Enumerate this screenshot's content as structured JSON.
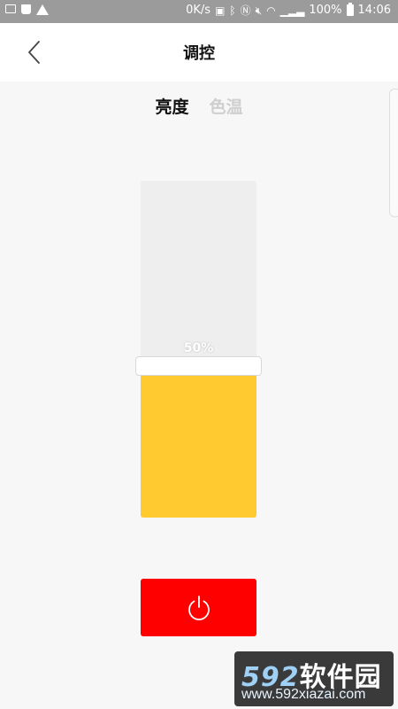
{
  "statusbar": {
    "speed": "0K/s",
    "battery_percent": "100%",
    "time": "14:06"
  },
  "header": {
    "title": "调控",
    "back_icon": "chevron-left-icon"
  },
  "tabs": [
    {
      "label": "亮度",
      "active": true
    },
    {
      "label": "色温",
      "active": false
    }
  ],
  "slider": {
    "value": 50,
    "value_label": "50%",
    "fill_color": "#ffc930",
    "track_color": "#eeeeee"
  },
  "power_button": {
    "icon": "power-icon",
    "color": "#ff0000"
  },
  "watermark": {
    "brand_digits": "592",
    "brand_text": "软件园",
    "url": "www.592xiazai.com"
  }
}
